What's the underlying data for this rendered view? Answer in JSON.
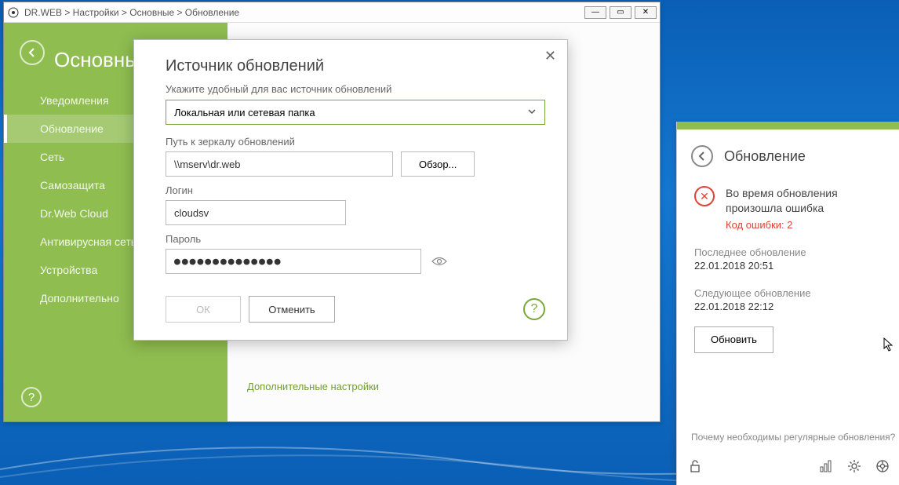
{
  "breadcrumb": "DR.WEB > Настройки > Основные > Обновление",
  "sidebar": {
    "title": "Основные",
    "items": [
      {
        "label": "Уведомления"
      },
      {
        "label": "Обновление"
      },
      {
        "label": "Сеть"
      },
      {
        "label": "Самозащита"
      },
      {
        "label": "Dr.Web Cloud"
      },
      {
        "label": "Антивирусная сеть"
      },
      {
        "label": "Устройства"
      },
      {
        "label": "Дополнительно"
      }
    ],
    "active_index": 1
  },
  "content": {
    "extra_link": "Дополнительные настройки"
  },
  "modal": {
    "title": "Источник обновлений",
    "subtitle": "Укажите удобный для вас источник обновлений",
    "dropdown_value": "Локальная или сетевая папка",
    "path_label": "Путь к зеркалу обновлений",
    "path_value": "\\\\mserv\\dr.web",
    "browse_label": "Обзор...",
    "login_label": "Логин",
    "login_value": "cloudsv",
    "password_label": "Пароль",
    "password_mask": "●●●●●●●●●●●●●●",
    "ok_label": "ОК",
    "cancel_label": "Отменить"
  },
  "right": {
    "title": "Обновление",
    "status_text": "Во время обновления произошла ошибка",
    "error_code": "Код ошибки: 2",
    "last_label": "Последнее обновление",
    "last_value": "22.01.2018 20:51",
    "next_label": "Следующее обновление",
    "next_value": "22.01.2018 22:12",
    "update_btn": "Обновить",
    "footer_link": "Почему необходимы регулярные обновления?"
  }
}
